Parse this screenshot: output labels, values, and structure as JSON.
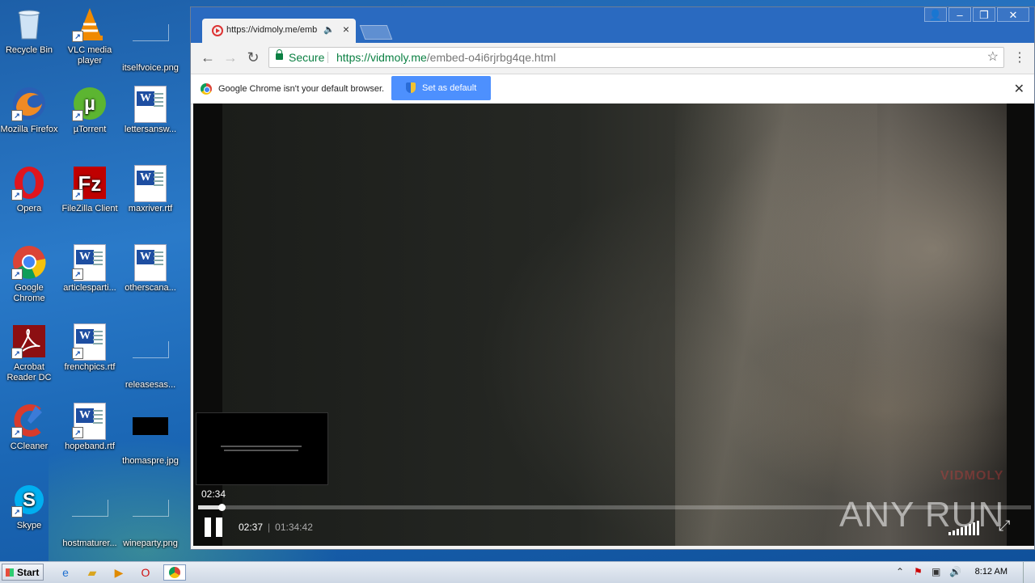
{
  "desktop": {
    "icons": [
      {
        "label": "Recycle Bin"
      },
      {
        "label": "VLC media player"
      },
      {
        "label": "itselfvoice.png"
      },
      {
        "label": "Mozilla Firefox"
      },
      {
        "label": "µTorrent"
      },
      {
        "label": "lettersansw..."
      },
      {
        "label": "Opera"
      },
      {
        "label": "FileZilla Client"
      },
      {
        "label": "maxriver.rtf"
      },
      {
        "label": "Google Chrome"
      },
      {
        "label": "articlesparti..."
      },
      {
        "label": "otherscana..."
      },
      {
        "label": "Acrobat Reader DC"
      },
      {
        "label": "frenchpics.rtf"
      },
      {
        "label": "releasesas..."
      },
      {
        "label": "CCleaner"
      },
      {
        "label": "hopeband.rtf"
      },
      {
        "label": "thomaspre.jpg"
      },
      {
        "label": "Skype"
      },
      {
        "label": "hostmaturer..."
      },
      {
        "label": "wineparty.png"
      }
    ]
  },
  "browser": {
    "tab_title": "https://vidmoly.me/emb",
    "address": {
      "secure_label": "Secure",
      "url_host": "https://vidmoly.me",
      "url_path": "/embed-o4i6rjrbg4qe.html"
    },
    "infobar": {
      "message": "Google Chrome isn't your default browser.",
      "button": "Set as default"
    }
  },
  "player": {
    "hover_time": "02:34",
    "current_time": "02:37",
    "separator": "|",
    "total_time": "01:34:42",
    "progress_fraction": 0.028,
    "brand": "VIDMOLY"
  },
  "watermark": "ANY RUN",
  "taskbar": {
    "start_label": "Start",
    "clock": "8:12 AM"
  }
}
